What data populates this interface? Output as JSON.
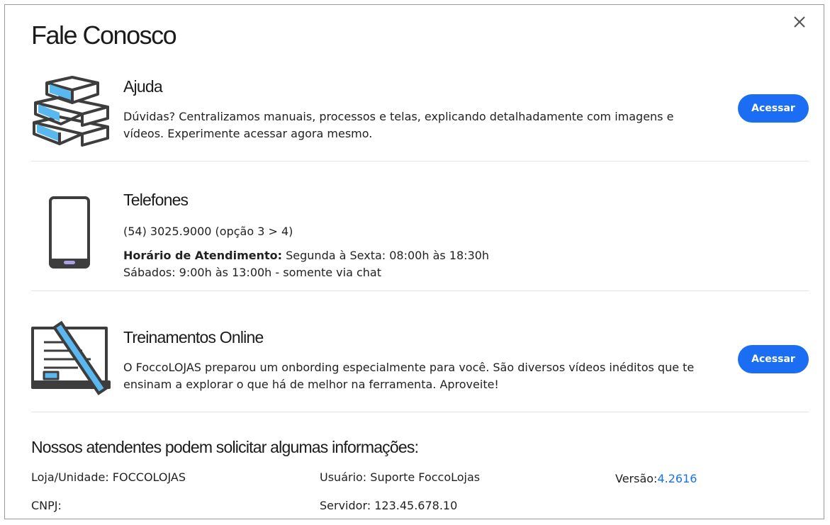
{
  "dialog": {
    "title": "Fale Conosco"
  },
  "sections": {
    "ajuda": {
      "title": "Ajuda",
      "line1": "Dúvidas? Centralizamos manuais, processos e telas, explicando detalhadamente com imagens e",
      "line2": "vídeos. Experimente acessar agora mesmo.",
      "button": "Acessar"
    },
    "telefones": {
      "title": "Telefones",
      "phone": "(54) 3025.9000 (opção 3 > 4)",
      "hours_label": "Horário de Atendimento:",
      "hours_weekdays": " Segunda à Sexta: 08:00h às 18:30h",
      "hours_saturday": "Sábados: 9:00h às 13:00h - somente via chat"
    },
    "treinamentos": {
      "title": "Treinamentos Online",
      "line1": "O FoccoLOJAS preparou um onbording especialmente para você. São diversos vídeos inéditos que te",
      "line2": "ensinam a explorar o que há de melhor na ferramenta. Aproveite!",
      "button": "Acessar"
    }
  },
  "info": {
    "title": "Nossos atendentes podem solicitar algumas informações:",
    "loja": "Loja/Unidade: FOCCOLOJAS",
    "usuario": "Usuário: Suporte FoccoLojas",
    "versao_label": "Versão:",
    "versao_value": "4.2616",
    "cnpj": "CNPJ:",
    "servidor": "Servidor: 123.45.678.10"
  },
  "colors": {
    "accent": "#1b6ef3",
    "icon_blue": "#5ab8ee",
    "icon_dark": "#3d3d3d"
  }
}
